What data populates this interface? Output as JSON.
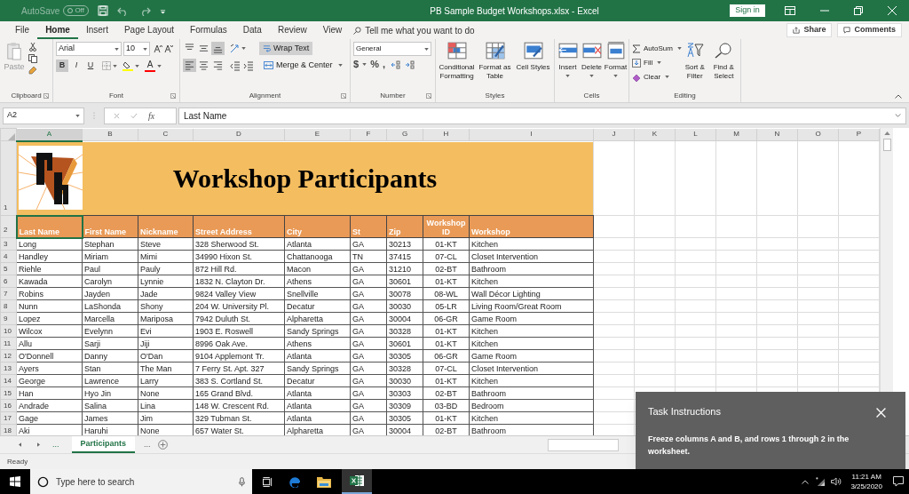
{
  "title_bar": {
    "autosave": {
      "label": "AutoSave",
      "state_text": "Off",
      "on": false
    },
    "title": "PB Sample Budget Workshops.xlsx - Excel",
    "sign_in": "Sign in"
  },
  "ribbon_tabs": [
    {
      "label": "File",
      "selected": false
    },
    {
      "label": "Home",
      "selected": true
    },
    {
      "label": "Insert",
      "selected": false
    },
    {
      "label": "Page Layout",
      "selected": false
    },
    {
      "label": "Formulas",
      "selected": false
    },
    {
      "label": "Data",
      "selected": false
    },
    {
      "label": "Review",
      "selected": false
    },
    {
      "label": "View",
      "selected": false
    }
  ],
  "tell_me": {
    "placeholder": "Tell me what you want to do"
  },
  "share": "Share",
  "comments": "Comments",
  "ribbon": {
    "clipboard": {
      "label": "Clipboard",
      "paste": "Paste"
    },
    "font": {
      "label": "Font",
      "name": "Arial",
      "size": "10",
      "style_buttons": [
        {
          "label": "B",
          "pressed": true
        },
        {
          "label": "I",
          "pressed": false
        },
        {
          "label": "U",
          "pressed": false
        }
      ],
      "font_color_label": "A"
    },
    "alignment": {
      "label": "Alignment",
      "vertical": [
        {
          "kind": "top",
          "pressed": false
        },
        {
          "kind": "middle",
          "pressed": false
        },
        {
          "kind": "bottom",
          "pressed": true
        }
      ],
      "horizontal": [
        {
          "kind": "left",
          "pressed": true
        },
        {
          "kind": "center",
          "pressed": false
        },
        {
          "kind": "right",
          "pressed": false
        }
      ],
      "wrap_text": {
        "label": "Wrap Text",
        "pressed": true
      },
      "merge": "Merge & Center"
    },
    "number": {
      "label": "Number",
      "format": "General",
      "symbols": [
        "$",
        "%",
        ","
      ]
    },
    "styles": {
      "label": "Styles",
      "buttons": [
        "Conditional Formatting",
        "Format as Table",
        "Cell Styles"
      ]
    },
    "cells": {
      "label": "Cells",
      "buttons": [
        "Insert",
        "Delete",
        "Format"
      ]
    },
    "editing": {
      "label": "Editing",
      "small": [
        "AutoSum",
        "Fill",
        "Clear"
      ],
      "buttons": [
        "Sort & Filter",
        "Find & Select"
      ]
    }
  },
  "formula_bar": {
    "name_box": "A2",
    "function_label": "fx",
    "value": "Last Name"
  },
  "columns": [
    {
      "label": "A",
      "selected": true
    },
    {
      "label": "B",
      "selected": false
    },
    {
      "label": "C",
      "selected": false
    },
    {
      "label": "D",
      "selected": false
    },
    {
      "label": "E",
      "selected": false
    },
    {
      "label": "F",
      "selected": false
    },
    {
      "label": "G",
      "selected": false
    },
    {
      "label": "H",
      "selected": false
    },
    {
      "label": "I",
      "selected": false
    },
    {
      "label": "J",
      "selected": false
    },
    {
      "label": "K",
      "selected": false
    },
    {
      "label": "L",
      "selected": false
    },
    {
      "label": "M",
      "selected": false
    },
    {
      "label": "N",
      "selected": false
    },
    {
      "label": "O",
      "selected": false
    },
    {
      "label": "P",
      "selected": false
    }
  ],
  "sheet": {
    "title": "Workshop Participants",
    "banner_row": "1",
    "header_row": "2",
    "headers": [
      "Last Name",
      "First Name",
      "Nickname",
      "Street Address",
      "City",
      "St",
      "Zip",
      "Workshop ID",
      "Workshop"
    ],
    "rows": [
      {
        "row": "3",
        "cells": [
          "Long",
          "Stephan",
          "Steve",
          "328 Sherwood St.",
          "Atlanta",
          "GA",
          "30213",
          "01-KT",
          "Kitchen"
        ]
      },
      {
        "row": "4",
        "cells": [
          "Handley",
          "Miriam",
          "Mimi",
          "34990 Hixon St.",
          "Chattanooga",
          "TN",
          "37415",
          "07-CL",
          "Closet Intervention"
        ]
      },
      {
        "row": "5",
        "cells": [
          "Riehle",
          "Paul",
          "Pauly",
          "872 Hill Rd.",
          "Macon",
          "GA",
          "31210",
          "02-BT",
          "Bathroom"
        ]
      },
      {
        "row": "6",
        "cells": [
          "Kawada",
          "Carolyn",
          "Lynnie",
          "1832 N. Clayton Dr.",
          "Athens",
          "GA",
          "30601",
          "01-KT",
          "Kitchen"
        ]
      },
      {
        "row": "7",
        "cells": [
          "Robins",
          "Jayden",
          "Jade",
          "9824 Valley View",
          "Snellville",
          "GA",
          "30078",
          "08-WL",
          "Wall Décor Lighting"
        ]
      },
      {
        "row": "8",
        "cells": [
          "Nunn",
          "LaShonda",
          "Shony",
          "204 W. University Pl.",
          "Decatur",
          "GA",
          "30030",
          "05-LR",
          "Living Room/Great Room"
        ]
      },
      {
        "row": "9",
        "cells": [
          "Lopez",
          "Marcella",
          "Mariposa",
          "7942 Duluth St.",
          "Alpharetta",
          "GA",
          "30004",
          "06-GR",
          "Game Room"
        ]
      },
      {
        "row": "10",
        "cells": [
          "Wilcox",
          "Evelynn",
          "Evi",
          "1903 E. Roswell",
          "Sandy Springs",
          "GA",
          "30328",
          "01-KT",
          "Kitchen"
        ]
      },
      {
        "row": "11",
        "cells": [
          "Allu",
          "Sarji",
          "Jiji",
          "8996 Oak Ave.",
          "Athens",
          "GA",
          "30601",
          "01-KT",
          "Kitchen"
        ]
      },
      {
        "row": "12",
        "cells": [
          "O'Donnell",
          "Danny",
          "O'Dan",
          "9104 Applemont Tr.",
          "Atlanta",
          "GA",
          "30305",
          "06-GR",
          "Game Room"
        ]
      },
      {
        "row": "13",
        "cells": [
          "Ayers",
          "Stan",
          "The Man",
          "7 Ferry St. Apt. 327",
          "Sandy Springs",
          "GA",
          "30328",
          "07-CL",
          "Closet Intervention"
        ]
      },
      {
        "row": "14",
        "cells": [
          "George",
          "Lawrence",
          "Larry",
          "383 S. Cortland St.",
          "Decatur",
          "GA",
          "30030",
          "01-KT",
          "Kitchen"
        ]
      },
      {
        "row": "15",
        "cells": [
          "Han",
          "Hyo Jin",
          "None",
          "165 Grand Blvd.",
          "Atlanta",
          "GA",
          "30303",
          "02-BT",
          "Bathroom"
        ]
      },
      {
        "row": "16",
        "cells": [
          "Andrade",
          "Salina",
          "Lina",
          "148 W. Crescent Rd.",
          "Atlanta",
          "GA",
          "30309",
          "03-BD",
          "Bedroom"
        ]
      },
      {
        "row": "17",
        "cells": [
          "Gage",
          "James",
          "Jim",
          "329 Tubman St.",
          "Atlanta",
          "GA",
          "30305",
          "01-KT",
          "Kitchen"
        ]
      },
      {
        "row": "18",
        "cells": [
          "Aki",
          "Haruhi",
          "None",
          "657 Water St.",
          "Alpharetta",
          "GA",
          "30004",
          "02-BT",
          "Bathroom"
        ]
      }
    ]
  },
  "sheet_tabs": {
    "overflow_left": "...",
    "tabs": [
      {
        "label": "Participants",
        "selected": true
      }
    ],
    "overflow_right": "..."
  },
  "status_bar": {
    "text": "Ready"
  },
  "task_panel": {
    "title": "Task Instructions",
    "text": "Freeze columns A and B, and rows 1 through 2 in the worksheet."
  },
  "taskbar": {
    "search_placeholder": "Type here to search",
    "time": "11:21 AM",
    "date": "3/25/2020"
  }
}
